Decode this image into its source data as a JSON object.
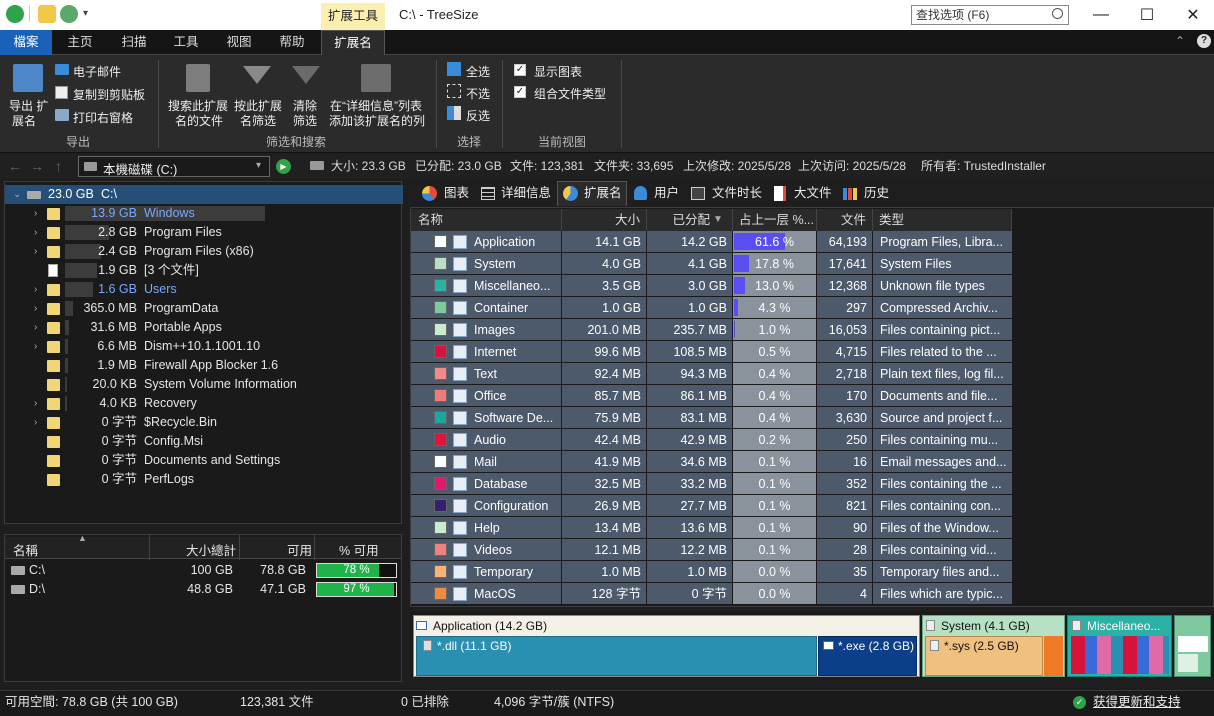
{
  "title_bar": {
    "context_tab": "扩展工具",
    "window_title": "C:\\ - TreeSize",
    "search_placeholder": "查找选项 (F6)"
  },
  "menu_tabs": [
    "檔案",
    "主页",
    "扫描",
    "工具",
    "视图",
    "帮助",
    "扩展名"
  ],
  "ribbon": {
    "export_label_1": "导出 扩",
    "export_label_2": "展名",
    "email": "电子邮件",
    "copy": "复制到剪贴板",
    "print": "打印右窗格",
    "group_export": "导出",
    "search_files_1": "搜索此扩展",
    "search_files_2": "名的文件",
    "filter_ext_1": "按此扩展",
    "filter_ext_2": "名筛选",
    "clear_filter_1": "清除",
    "clear_filter_2": "筛选",
    "add_column_1": "在“详细信息”列表",
    "add_column_2": "添加该扩展名的列",
    "group_filter": "筛选和搜索",
    "select_all": "全选",
    "select_none": "不选",
    "invert": "反选",
    "group_select": "选择",
    "show_chart": "显示图表",
    "combine_types": "组合文件类型",
    "group_view": "当前视图"
  },
  "address": {
    "path": "本機磁碟 (C:)",
    "size": "大小: 23.3 GB",
    "allocated": "已分配: 23.0 GB",
    "files": "文件: 123,381",
    "folders": "文件夹: 33,695",
    "modified": "上次修改: 2025/5/28",
    "accessed": "上次访问: 2025/5/28",
    "owner": "所有者: TrustedInstaller"
  },
  "tree": {
    "root_size": "23.0 GB",
    "root_name": "C:\\",
    "items": [
      {
        "size": "13.9 GB",
        "name": "Windows"
      },
      {
        "size": "2.8 GB",
        "name": "Program Files"
      },
      {
        "size": "2.4 GB",
        "name": "Program Files (x86)"
      },
      {
        "size": "1.9 GB",
        "name": "[3 个文件]"
      },
      {
        "size": "1.6 GB",
        "name": "Users"
      },
      {
        "size": "365.0 MB",
        "name": "ProgramData"
      },
      {
        "size": "31.6 MB",
        "name": "Portable Apps"
      },
      {
        "size": "6.6 MB",
        "name": "Dism++10.1.1001.10"
      },
      {
        "size": "1.9 MB",
        "name": "Firewall App Blocker 1.6"
      },
      {
        "size": "20.0 KB",
        "name": "System Volume Information"
      },
      {
        "size": "4.0 KB",
        "name": "Recovery"
      },
      {
        "size": "0 字节",
        "name": "$Recycle.Bin"
      },
      {
        "size": "0 字节",
        "name": "Config.Msi"
      },
      {
        "size": "0 字节",
        "name": "Documents and Settings"
      },
      {
        "size": "0 字节",
        "name": "PerfLogs"
      }
    ]
  },
  "drives": {
    "headers": [
      "名稱",
      "大小總計",
      "可用",
      "% 可用"
    ],
    "rows": [
      {
        "name": "C:\\",
        "total": "100 GB",
        "free": "78.8 GB",
        "pct": "78 %",
        "pct_value": 78
      },
      {
        "name": "D:\\",
        "total": "48.8 GB",
        "free": "47.1 GB",
        "pct": "97 %",
        "pct_value": 97
      }
    ]
  },
  "view_tabs": [
    "图表",
    "详细信息",
    "扩展名",
    "用户",
    "文件时长",
    "大文件",
    "历史"
  ],
  "grid": {
    "headers": [
      "名称",
      "大小",
      "已分配",
      "占上一层 %...",
      "文件",
      "类型"
    ],
    "rows": [
      {
        "name": "Application",
        "size": "14.1 GB",
        "alloc": "14.2 GB",
        "pct": "61.6 %",
        "pct_value": 61.6,
        "files": "64,193",
        "type": "Program Files, Libra...",
        "color": "#ffffff"
      },
      {
        "name": "System",
        "size": "4.0 GB",
        "alloc": "4.1 GB",
        "pct": "17.8 %",
        "pct_value": 17.8,
        "files": "17,641",
        "type": "System Files",
        "color": "#b7e1c4"
      },
      {
        "name": "Miscellaneo...",
        "size": "3.5 GB",
        "alloc": "3.0 GB",
        "pct": "13.0 %",
        "pct_value": 13.0,
        "files": "12,368",
        "type": "Unknown file types",
        "color": "#2ab3a5"
      },
      {
        "name": "Container",
        "size": "1.0 GB",
        "alloc": "1.0 GB",
        "pct": "4.3 %",
        "pct_value": 4.3,
        "files": "297",
        "type": "Compressed Archiv...",
        "color": "#7fc9a0"
      },
      {
        "name": "Images",
        "size": "201.0 MB",
        "alloc": "235.7 MB",
        "pct": "1.0 %",
        "pct_value": 1.0,
        "files": "16,053",
        "type": "Files containing pict...",
        "color": "#c7ecd0"
      },
      {
        "name": "Internet",
        "size": "99.6 MB",
        "alloc": "108.5 MB",
        "pct": "0.5 %",
        "pct_value": 0.5,
        "files": "4,715",
        "type": "Files related to the ...",
        "color": "#d6143a"
      },
      {
        "name": "Text",
        "size": "92.4 MB",
        "alloc": "94.3 MB",
        "pct": "0.4 %",
        "pct_value": 0.4,
        "files": "2,718",
        "type": "Plain text files, log fil...",
        "color": "#f28a8a"
      },
      {
        "name": "Office",
        "size": "85.7 MB",
        "alloc": "86.1 MB",
        "pct": "0.4 %",
        "pct_value": 0.4,
        "files": "170",
        "type": "Documents and file...",
        "color": "#f27a7a"
      },
      {
        "name": "Software De...",
        "size": "75.9 MB",
        "alloc": "83.1 MB",
        "pct": "0.4 %",
        "pct_value": 0.4,
        "files": "3,630",
        "type": "Source and project f...",
        "color": "#1aa89d"
      },
      {
        "name": "Audio",
        "size": "42.4 MB",
        "alloc": "42.9 MB",
        "pct": "0.2 %",
        "pct_value": 0.2,
        "files": "250",
        "type": "Files containing mu...",
        "color": "#e0143c"
      },
      {
        "name": "Mail",
        "size": "41.9 MB",
        "alloc": "34.6 MB",
        "pct": "0.1 %",
        "pct_value": 0.1,
        "files": "16",
        "type": "Email messages and...",
        "color": "#ffffff"
      },
      {
        "name": "Database",
        "size": "32.5 MB",
        "alloc": "33.2 MB",
        "pct": "0.1 %",
        "pct_value": 0.1,
        "files": "352",
        "type": "Files containing the ...",
        "color": "#e2186a"
      },
      {
        "name": "Configuration",
        "size": "26.9 MB",
        "alloc": "27.7 MB",
        "pct": "0.1 %",
        "pct_value": 0.1,
        "files": "821",
        "type": "Files containing con...",
        "color": "#35206e"
      },
      {
        "name": "Help",
        "size": "13.4 MB",
        "alloc": "13.6 MB",
        "pct": "0.1 %",
        "pct_value": 0.1,
        "files": "90",
        "type": "Files of the Window...",
        "color": "#c7ecd0"
      },
      {
        "name": "Videos",
        "size": "12.1 MB",
        "alloc": "12.2 MB",
        "pct": "0.1 %",
        "pct_value": 0.1,
        "files": "28",
        "type": "Files containing vid...",
        "color": "#f28080"
      },
      {
        "name": "Temporary",
        "size": "1.0 MB",
        "alloc": "1.0 MB",
        "pct": "0.0 %",
        "pct_value": 0.0,
        "files": "35",
        "type": "Temporary files and...",
        "color": "#f8b478"
      },
      {
        "name": "MacOS",
        "size": "128 字节",
        "alloc": "0 字节",
        "pct": "0.0 %",
        "pct_value": 0.0,
        "files": "4",
        "type": "Files which are typic...",
        "color": "#f08a40"
      }
    ]
  },
  "treemap": {
    "application": "Application (14.2 GB)",
    "dll": "*.dll (11.1 GB)",
    "exe": "*.exe (2.8 GB)",
    "system": "System (4.1 GB)",
    "sys": "*.sys (2.5 GB)",
    "misc": "Miscellaneo...",
    "colors": {
      "application": "#2a8fb0",
      "system": "#f0c080",
      "misc": "#2ab3a5"
    }
  },
  "status": {
    "free": "可用空間: 78.8 GB (共 100 GB)",
    "files": "123,381 文件",
    "excluded": "0 已排除",
    "cluster": "4,096 字节/簇 (NTFS)",
    "update": "获得更新和支持"
  }
}
